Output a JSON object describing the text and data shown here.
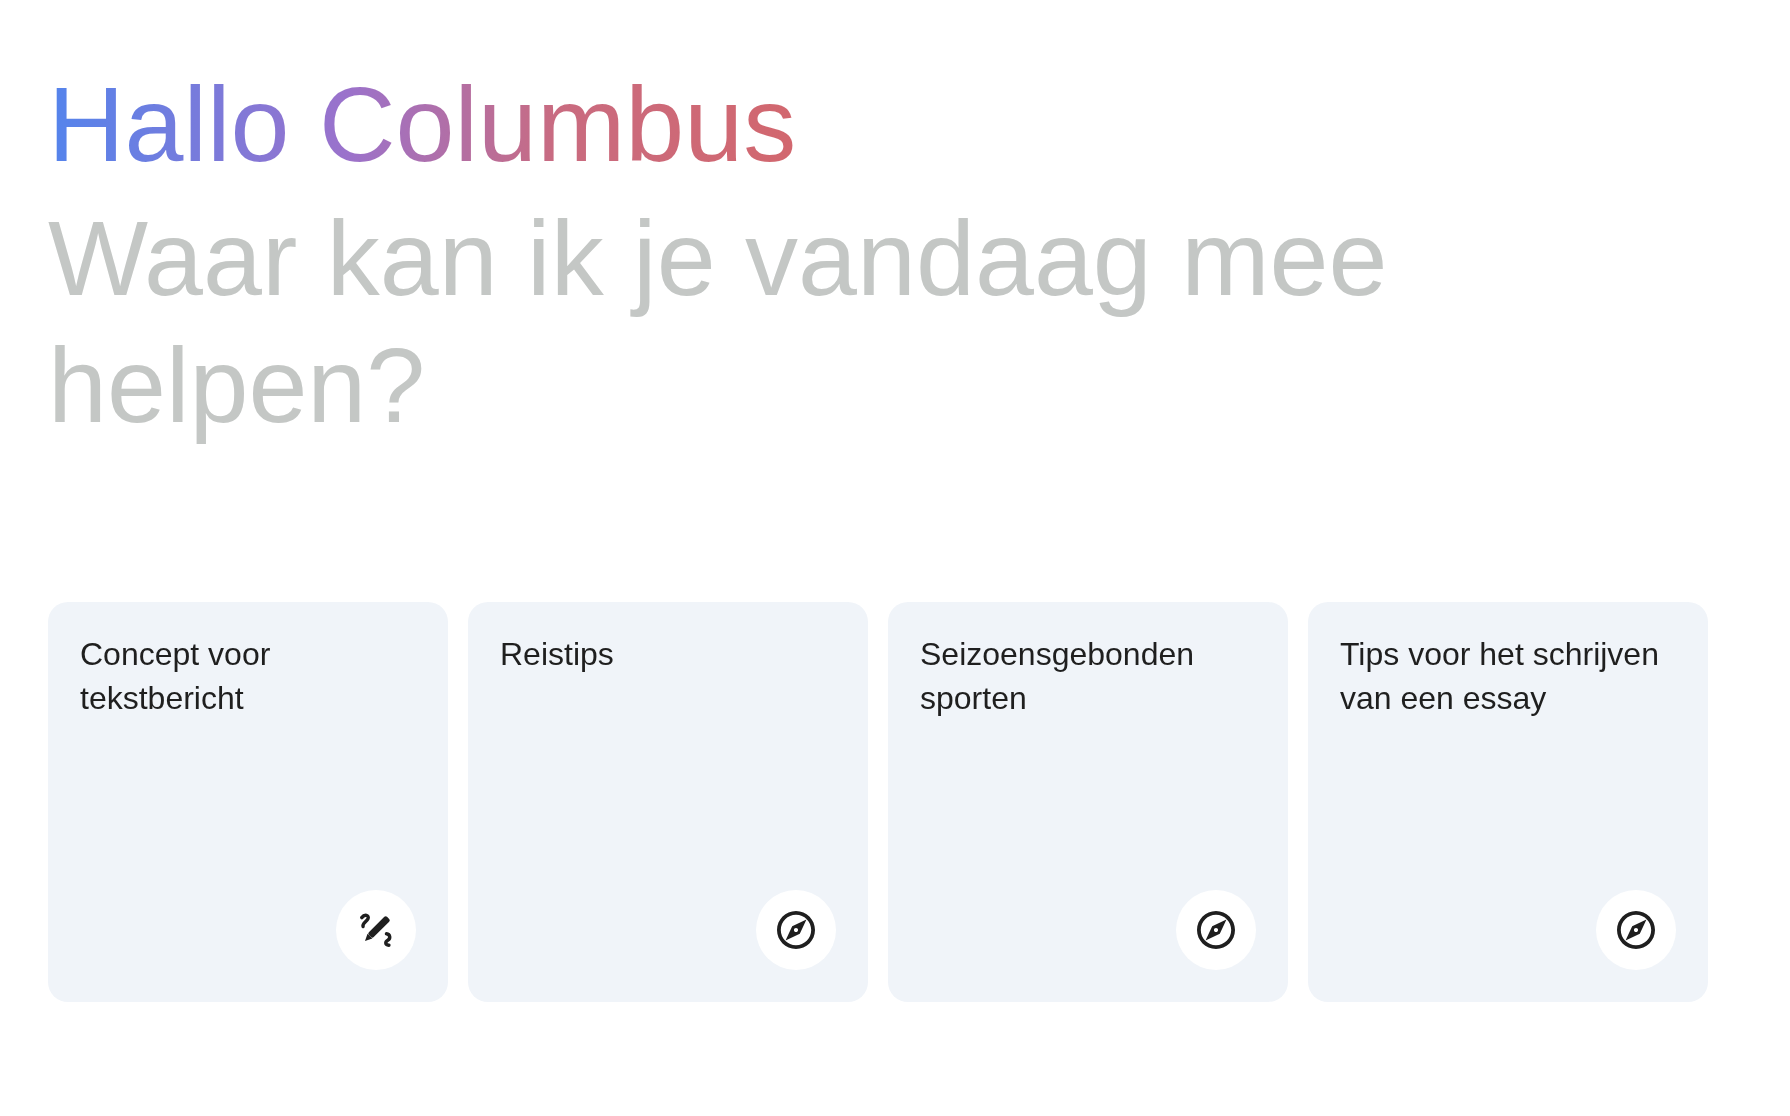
{
  "greeting": "Hallo Columbus",
  "prompt": "Waar kan ik je vandaag mee helpen?",
  "suggestions": [
    {
      "text": "Concept voor tekstbericht",
      "kind": "write"
    },
    {
      "text": "Reistips",
      "kind": "explore"
    },
    {
      "text": "Seizoensgebonden sporten",
      "kind": "explore"
    },
    {
      "text": "Tips voor het schrijven van een essay",
      "kind": "explore"
    }
  ]
}
